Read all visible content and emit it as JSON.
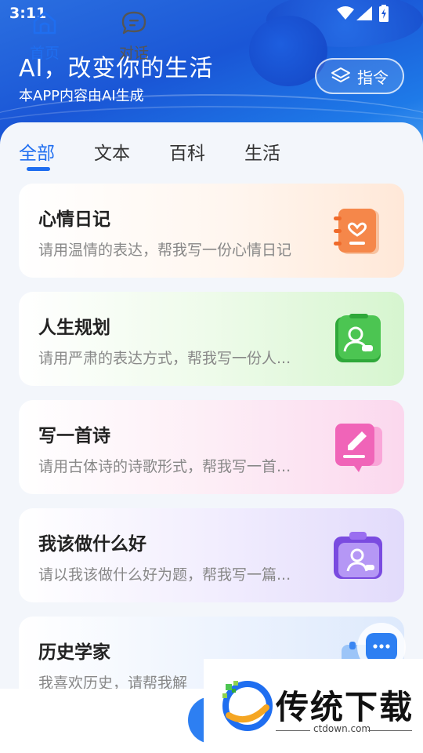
{
  "status_bar": {
    "time": "3:11"
  },
  "header": {
    "title": "AI，改变你的生活",
    "subtitle": "本APP内容由AI生成",
    "command_button_label": "指令"
  },
  "tabs": [
    {
      "label": "全部",
      "active": true
    },
    {
      "label": "文本",
      "active": false
    },
    {
      "label": "百科",
      "active": false
    },
    {
      "label": "生活",
      "active": false
    }
  ],
  "cards": [
    {
      "title": "心情日记",
      "desc": "请用温情的表达，帮我写一份心情日记",
      "icon": "diary-icon",
      "accent": "#f5874a"
    },
    {
      "title": "人生规划",
      "desc": "请用严肃的表达方式，帮我写一份人...",
      "icon": "life-plan-icon",
      "accent": "#4cc552"
    },
    {
      "title": "写一首诗",
      "desc": "请用古体诗的诗歌形式，帮我写一首...",
      "icon": "poem-icon",
      "accent": "#f064b8"
    },
    {
      "title": "我该做什么好",
      "desc": "请以我该做什么好为题，帮我写一篇...",
      "icon": "todo-icon",
      "accent": "#9a6ef0"
    },
    {
      "title": "历史学家",
      "desc": "我喜欢历史，请帮我解",
      "icon": "history-icon",
      "accent": "#3a86f2"
    }
  ],
  "bottom_nav": [
    {
      "label": "首页",
      "icon": "home-icon",
      "active": true
    },
    {
      "label": "对话",
      "icon": "chat-icon",
      "active": false
    }
  ],
  "watermark": {
    "brand": "传统下载",
    "url": "ctdown.com"
  },
  "colors": {
    "primary": "#1f6ef0",
    "hero_bg": "#1a56d6"
  }
}
